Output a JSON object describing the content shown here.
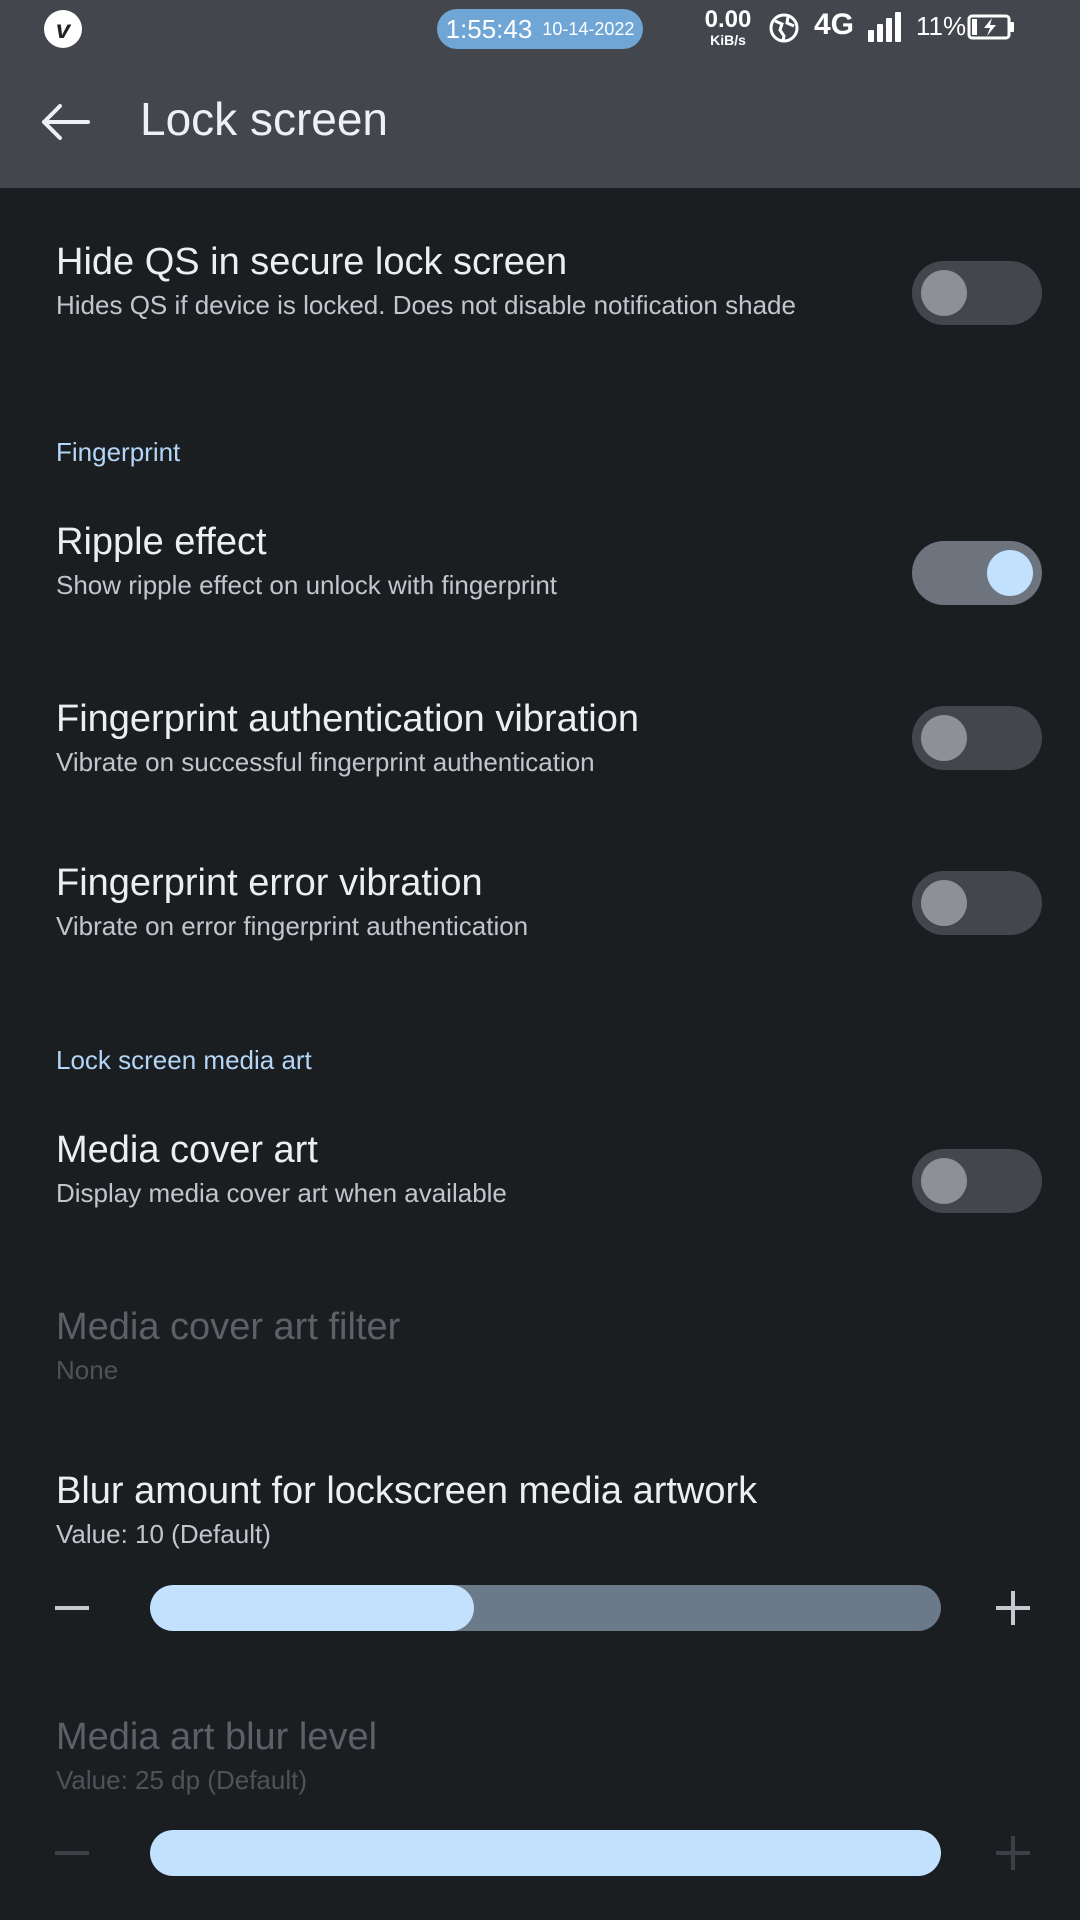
{
  "status_bar": {
    "clock_time": "1:55:43",
    "clock_date": "10-14-2022",
    "net_speed": "0.00",
    "net_speed_unit": "KiB/s",
    "network_type": "4G",
    "battery_percent": "11%"
  },
  "app_bar": {
    "title": "Lock screen"
  },
  "prefs": {
    "hide_qs": {
      "title": "Hide QS in secure lock screen",
      "summary": "Hides QS if device is locked. Does not disable notification shade",
      "enabled": false
    },
    "section_fingerprint": "Fingerprint",
    "ripple": {
      "title": "Ripple effect",
      "summary": "Show ripple effect on unlock with fingerprint",
      "enabled": true
    },
    "auth_vibration": {
      "title": "Fingerprint authentication vibration",
      "summary": "Vibrate on successful fingerprint authentication",
      "enabled": false
    },
    "error_vibration": {
      "title": "Fingerprint error vibration",
      "summary": "Vibrate on error fingerprint authentication",
      "enabled": false
    },
    "section_media_art": "Lock screen media art",
    "media_cover_art": {
      "title": "Media cover art",
      "summary": "Display media cover art when available",
      "enabled": false
    },
    "cover_art_filter": {
      "title": "Media cover art filter",
      "summary": "None"
    },
    "blur_amount": {
      "title": "Blur amount for lockscreen media artwork",
      "summary": "Value: 10 (Default)",
      "fill_fraction": 0.41
    },
    "blur_level": {
      "title": "Media art blur level",
      "summary": "Value: 25 dp (Default)",
      "fill_fraction": 1.0
    }
  },
  "colors": {
    "accent": "#c2e1ff",
    "section_header": "#b3d6f7",
    "background": "#1b1e21",
    "app_bar": "#43474d"
  }
}
